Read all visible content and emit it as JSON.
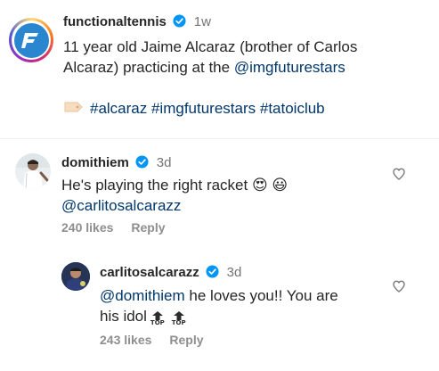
{
  "post": {
    "username": "functionaltennis",
    "time": "1w",
    "caption_line1": "11 year old Jaime Alcaraz (brother of Carlos",
    "caption_line2_prefix": "Alcaraz) practicing at the ",
    "caption_mention": "@imgfuturestars",
    "hashtags": "#alcaraz #imgfuturestars #tatoiclub"
  },
  "comments": [
    {
      "username": "domithiem",
      "time": "3d",
      "text": "He's playing the right racket",
      "emojis": "😍 😃",
      "mention": "@carlitosalcarazz",
      "likes": "240 likes",
      "reply": "Reply"
    },
    {
      "username": "carlitosalcarazz",
      "time": "3d",
      "mention": "@domithiem",
      "text_after_mention": " he loves you!! You are",
      "text_line2": "his idol",
      "top_badge": "TOP",
      "likes": "243 likes",
      "reply": "Reply"
    }
  ],
  "colors": {
    "link": "#00376b",
    "verified": "#0095f6",
    "muted": "#8e8e8e"
  },
  "icons": [
    "verified-badge-icon",
    "heart-icon",
    "top-arrow-icon",
    "tag-icon"
  ]
}
